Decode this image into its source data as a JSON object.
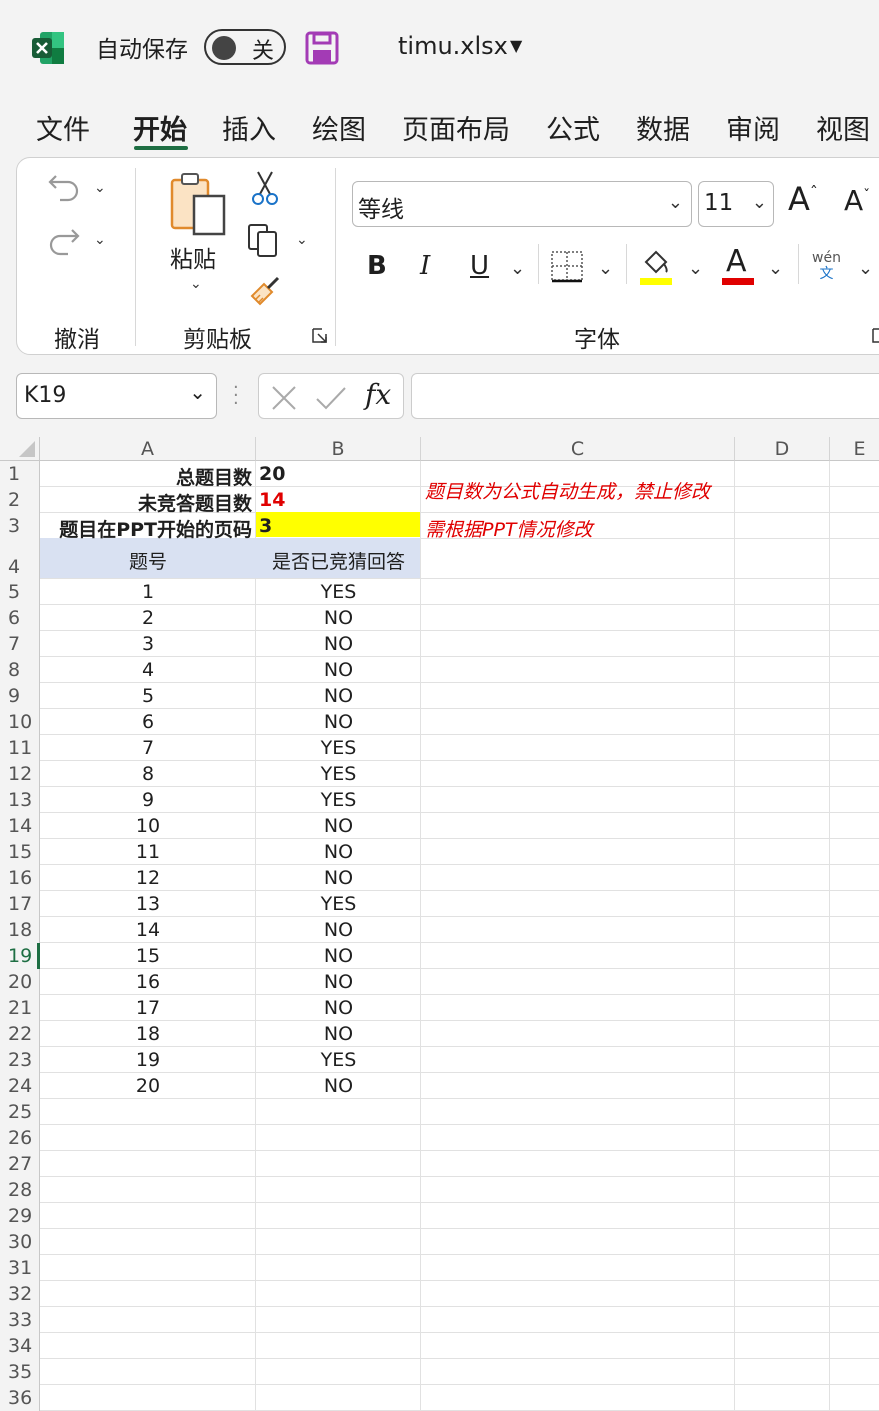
{
  "titlebar": {
    "autosave_label": "自动保存",
    "autosave_state": "关",
    "filename": "timu.xlsx"
  },
  "tabs": [
    "文件",
    "开始",
    "插入",
    "绘图",
    "页面布局",
    "公式",
    "数据",
    "审阅",
    "视图"
  ],
  "active_tab": "开始",
  "ribbon": {
    "undo_group": "撤消",
    "paste_label": "粘贴",
    "clipboard_group": "剪贴板",
    "font_name": "等线",
    "font_size": "11",
    "font_group": "字体",
    "bold": "B",
    "italic": "I",
    "underline": "U",
    "font_color_glyph": "A",
    "grow_font": "A",
    "shrink_font": "A",
    "phonetic_top": "wén",
    "phonetic_bottom": "文",
    "fill_color": "#ffff00",
    "font_color": "#e00000"
  },
  "formula_bar": {
    "name_box": "K19",
    "fx": "fx",
    "formula": ""
  },
  "sheet": {
    "columns": [
      "A",
      "B",
      "C",
      "D",
      "E"
    ],
    "row_numbers": [
      "1",
      "2",
      "3",
      "4",
      "5",
      "6",
      "7",
      "8",
      "9",
      "10",
      "11",
      "12",
      "13",
      "14",
      "15",
      "16",
      "17",
      "18",
      "19",
      "20",
      "21",
      "22",
      "23",
      "24",
      "25",
      "26",
      "27",
      "28",
      "29",
      "30",
      "31",
      "32",
      "33",
      "34",
      "35",
      "36"
    ],
    "selected_row": "19",
    "summary": {
      "total_label": "总题目数",
      "total_value": "20",
      "unanswered_label": "未竞答题目数",
      "unanswered_value": "14",
      "start_page_label": "题目在PPT开始的页码",
      "start_page_value": "3"
    },
    "notes": {
      "formula_note": "题目数为公式自动生成，禁止修改",
      "ppt_note": "需根据PPT情况修改"
    },
    "table_header": {
      "number": "题号",
      "answered": "是否已竞猜回答"
    },
    "table_rows": [
      {
        "num": "1",
        "answered": "YES"
      },
      {
        "num": "2",
        "answered": "NO"
      },
      {
        "num": "3",
        "answered": "NO"
      },
      {
        "num": "4",
        "answered": "NO"
      },
      {
        "num": "5",
        "answered": "NO"
      },
      {
        "num": "6",
        "answered": "NO"
      },
      {
        "num": "7",
        "answered": "YES"
      },
      {
        "num": "8",
        "answered": "YES"
      },
      {
        "num": "9",
        "answered": "YES"
      },
      {
        "num": "10",
        "answered": "NO"
      },
      {
        "num": "11",
        "answered": "NO"
      },
      {
        "num": "12",
        "answered": "NO"
      },
      {
        "num": "13",
        "answered": "YES"
      },
      {
        "num": "14",
        "answered": "NO"
      },
      {
        "num": "15",
        "answered": "NO"
      },
      {
        "num": "16",
        "answered": "NO"
      },
      {
        "num": "17",
        "answered": "NO"
      },
      {
        "num": "18",
        "answered": "NO"
      },
      {
        "num": "19",
        "answered": "YES"
      },
      {
        "num": "20",
        "answered": "NO"
      }
    ]
  }
}
